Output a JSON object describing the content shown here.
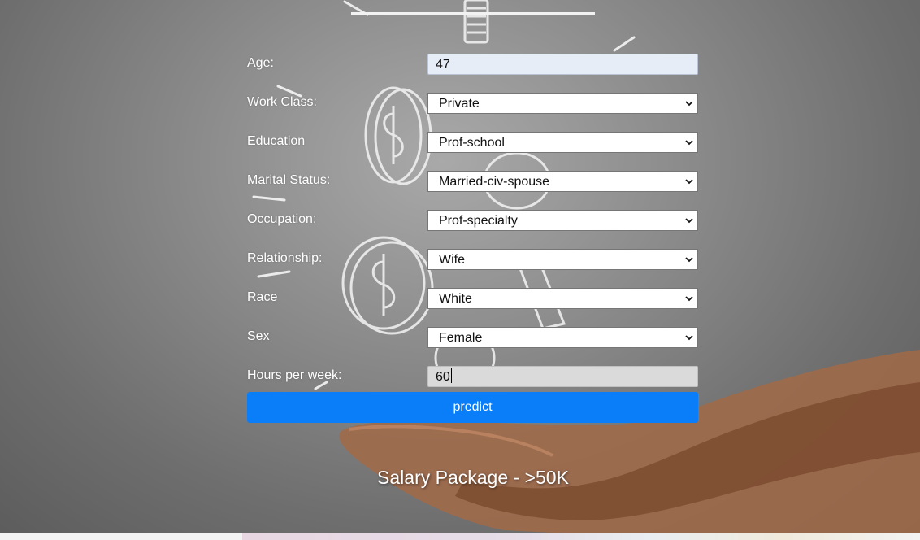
{
  "form": {
    "fields": [
      {
        "label": "Age:",
        "value": "47",
        "type": "text"
      },
      {
        "label": "Work Class:",
        "value": "Private",
        "type": "select"
      },
      {
        "label": "Education",
        "value": "Prof-school",
        "type": "select"
      },
      {
        "label": "Marital Status:",
        "value": "Married-civ-spouse",
        "type": "select"
      },
      {
        "label": "Occupation:",
        "value": "Prof-specialty",
        "type": "select"
      },
      {
        "label": "Relationship:",
        "value": "Wife",
        "type": "select"
      },
      {
        "label": "Race",
        "value": "White",
        "type": "select"
      },
      {
        "label": "Sex",
        "value": "Female",
        "type": "select"
      },
      {
        "label": "Hours per week:",
        "value": "60",
        "type": "text"
      }
    ],
    "submit_label": "predict"
  },
  "result": {
    "text": "Salary Package - >50K"
  },
  "colors": {
    "button": "#0a7ef8",
    "background": "#8c8c8c",
    "label_text": "#ffffff"
  },
  "icons": {
    "dropdown": "chevron-down-icon",
    "background_art": "coins-and-hands-illustration"
  }
}
